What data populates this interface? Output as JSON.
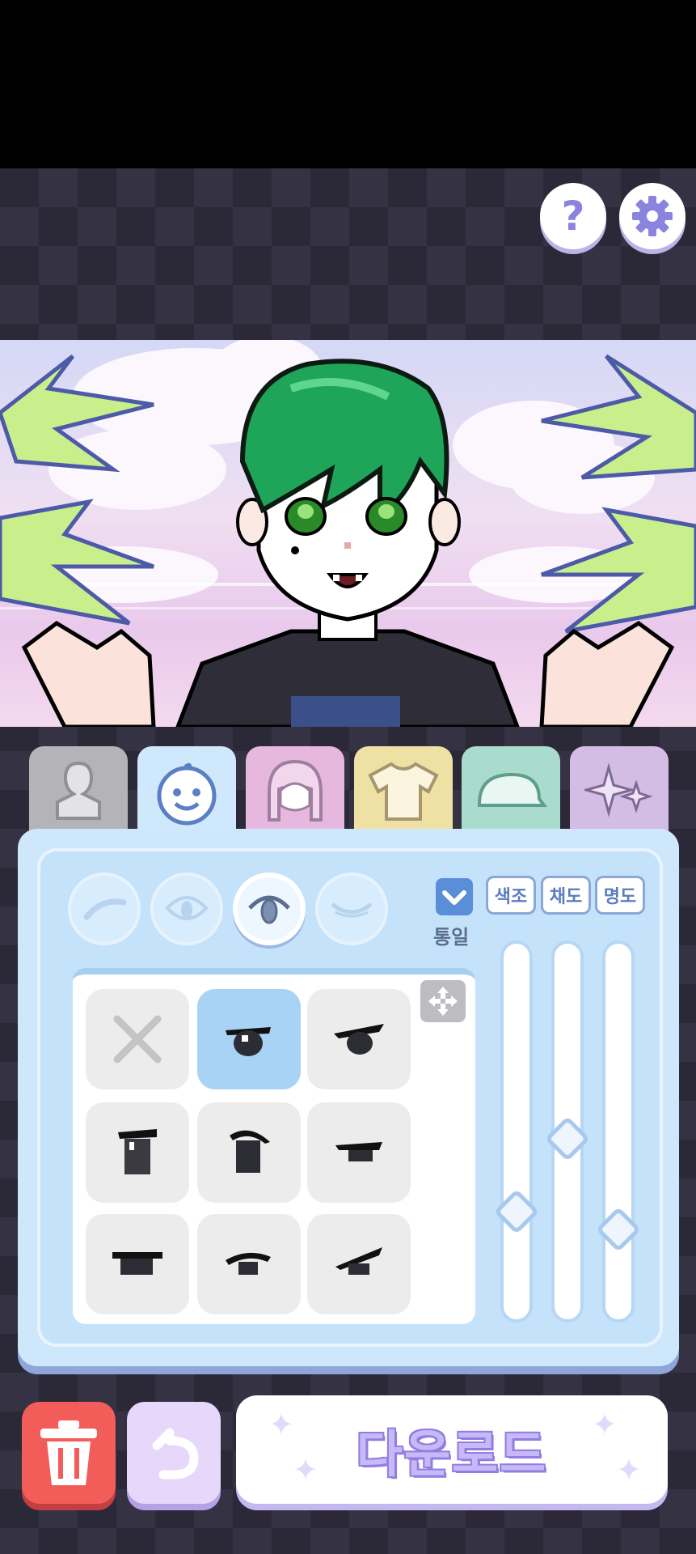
{
  "header": {
    "help_glyph": "?",
    "help_icon": "question-mark-icon",
    "settings_icon": "gear-icon"
  },
  "category_tabs": [
    {
      "id": "body",
      "icon": "body-silhouette-icon",
      "color": "#b4b4b8"
    },
    {
      "id": "face",
      "icon": "face-icon",
      "color": "#cfe8fb",
      "active": true
    },
    {
      "id": "hair",
      "icon": "hair-icon",
      "color": "#e7b8df"
    },
    {
      "id": "clothes",
      "icon": "tshirt-icon",
      "color": "#efe1a4"
    },
    {
      "id": "hat",
      "icon": "cap-icon",
      "color": "#a9dccc"
    },
    {
      "id": "effects",
      "icon": "sparkle-icon",
      "color": "#d3bde4"
    }
  ],
  "face_subtabs": [
    {
      "icon": "eyebrow-icon"
    },
    {
      "icon": "eye-outline-icon"
    },
    {
      "icon": "eye-icon",
      "active": true
    },
    {
      "icon": "closed-eye-icon"
    }
  ],
  "color_controls": {
    "unify_label": "통일",
    "unify_checked": true,
    "hue_label": "색조",
    "saturation_label": "채도",
    "brightness_label": "명도",
    "hue_level": 0.27,
    "saturation_level": 0.48,
    "brightness_level": 0.22
  },
  "eye_options": [
    {
      "icon": "none-x-icon"
    },
    {
      "icon": "eye-style-1-icon",
      "selected": true
    },
    {
      "icon": "eye-style-2-icon"
    },
    {
      "icon": "eye-style-3-icon"
    },
    {
      "icon": "eye-style-4-icon"
    },
    {
      "icon": "eye-style-5-icon"
    },
    {
      "icon": "eye-style-6-icon"
    },
    {
      "icon": "eye-style-7-icon"
    },
    {
      "icon": "eye-style-8-icon"
    }
  ],
  "bottom_bar": {
    "download_label": "다운로드",
    "trash_icon": "trash-icon",
    "undo_icon": "undo-icon",
    "delete_color": "#f25c59"
  }
}
